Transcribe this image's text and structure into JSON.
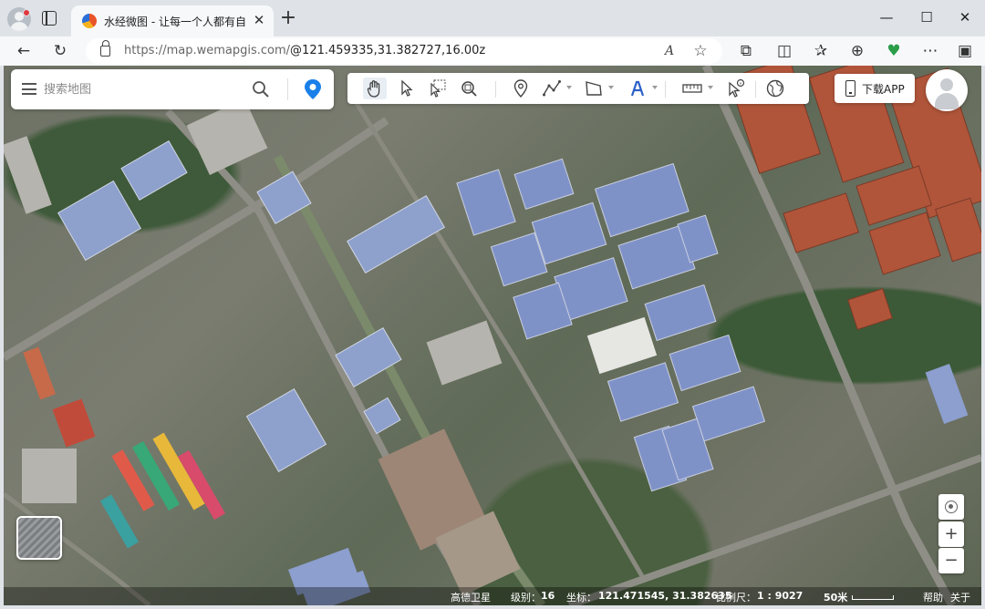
{
  "browser": {
    "tab_title": "水经微图 - 让每一个人都有自己的",
    "tab_close": "✕",
    "new_tab": "+",
    "window_controls": {
      "minimize": "—",
      "maximize": "☐",
      "close": "✕"
    },
    "url_host": "https://map.wemapgis.com/",
    "url_rest": "@121.459335,31.382727,16.00z",
    "nav": {
      "back": "←",
      "reload": "↻"
    },
    "addr_icons": {
      "read_aloud": "A",
      "favorite": "☆"
    },
    "toolbar_icons": {
      "extensions": "⧉",
      "split": "◫",
      "favorites": "✰",
      "collections": "⊕",
      "health": "♥",
      "more": "⋯",
      "sidebar": "▣"
    }
  },
  "map": {
    "search": {
      "placeholder": "搜索地图"
    },
    "download_label": "下载APP",
    "controls": {
      "zoom_in": "+",
      "zoom_out": "−"
    },
    "tools": [
      {
        "name": "pan-hand-icon"
      },
      {
        "name": "select-arrow-icon"
      },
      {
        "name": "box-select-icon"
      },
      {
        "name": "zoom-region-icon"
      },
      {
        "name": "marker-icon"
      },
      {
        "name": "polyline-icon"
      },
      {
        "name": "polygon-icon"
      },
      {
        "name": "text-icon"
      },
      {
        "name": "measure-ruler-icon"
      },
      {
        "name": "query-pointer-icon"
      },
      {
        "name": "globe-icon"
      }
    ],
    "status": {
      "source": "高德卫星",
      "level_label": "级别：",
      "level_value": "16",
      "coord_label": "坐标：",
      "coord_value": "121.471545, 31.382635",
      "scale_label": "比例尺：",
      "scale_value": "1 : 9027",
      "scale_bar_label": "50米",
      "help": "帮助",
      "about": "关于"
    }
  },
  "colors": {
    "accent": "#1677ff",
    "pin": "#1a7fe8",
    "roof_blue": "#7c8fc6",
    "roof_red": "#b0553a"
  }
}
